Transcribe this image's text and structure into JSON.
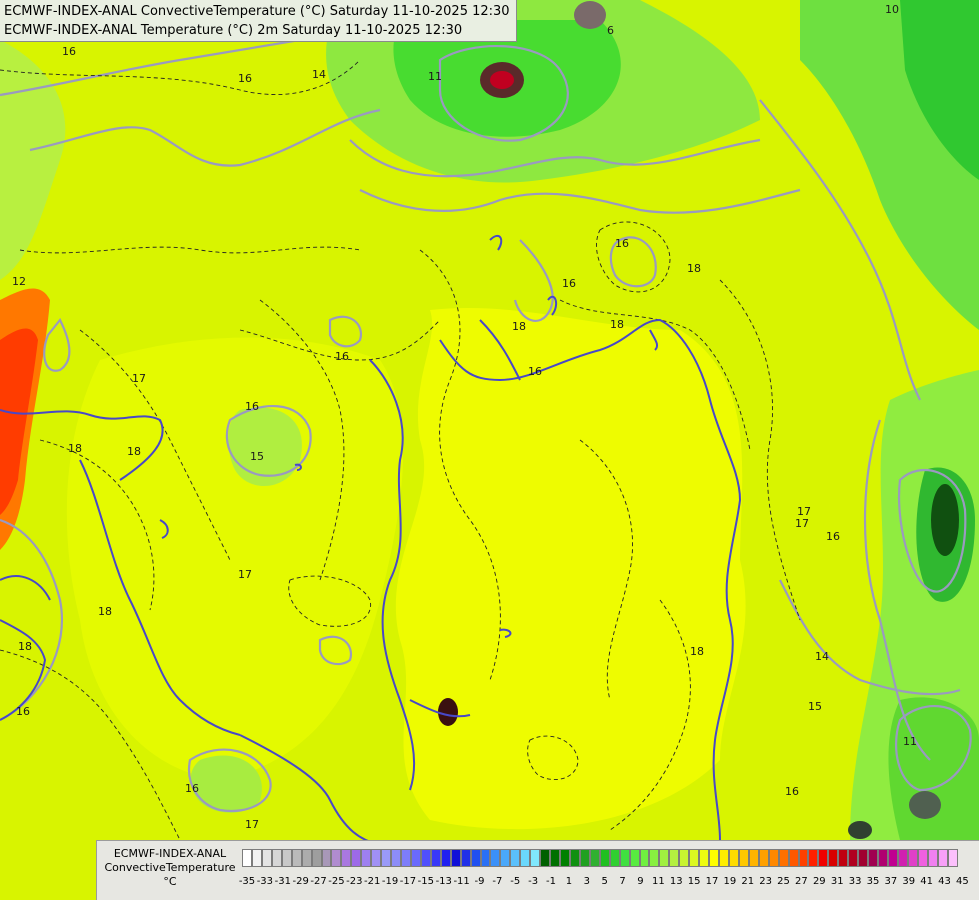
{
  "header": {
    "line1": "ECMWF-INDEX-ANAL ConvectiveTemperature (°C) Saturday 11-10-2025 12:30",
    "line2": "ECMWF-INDEX-ANAL Temperature (°C) 2m Saturday 11-10-2025 12:30"
  },
  "legend": {
    "title_line1": "ECMWF-INDEX-ANAL",
    "title_line2": "ConvectiveTemperature",
    "title_line3": "°C",
    "tick_labels": [
      "-35",
      "-33",
      "-31",
      "-29",
      "-27",
      "-25",
      "-23",
      "-21",
      "-19",
      "-17",
      "-15",
      "-13",
      "-11",
      "-9",
      "-7",
      "-5",
      "-3",
      "-1",
      "1",
      "3",
      "5",
      "7",
      "9",
      "11",
      "13",
      "15",
      "17",
      "19",
      "21",
      "23",
      "25",
      "27",
      "29",
      "31",
      "33",
      "35",
      "37",
      "39",
      "41",
      "43",
      "45"
    ],
    "colors": [
      "#ffffff",
      "#f2f2f2",
      "#e4e4e4",
      "#d6d6d6",
      "#c8c8c8",
      "#bababa",
      "#acacac",
      "#9e9e9e",
      "#a898b8",
      "#b08cd0",
      "#a978e0",
      "#9d6ae8",
      "#9e80f0",
      "#a090f5",
      "#9a9af8",
      "#8d8df8",
      "#7d7dfa",
      "#6a6afc",
      "#5050fc",
      "#3838f8",
      "#2020f0",
      "#1010d8",
      "#2030e8",
      "#2050f0",
      "#2a70f5",
      "#3a90f8",
      "#4aa8fa",
      "#5ac0fb",
      "#6ad8fc",
      "#80e8fd",
      "#006000",
      "#007000",
      "#008000",
      "#109010",
      "#20a020",
      "#30b030",
      "#20c020",
      "#30d030",
      "#40e040",
      "#58ec40",
      "#70f040",
      "#88f040",
      "#a0f040",
      "#b4f040",
      "#c8f430",
      "#dcf820",
      "#eefc10",
      "#ffff00",
      "#ffee00",
      "#ffdc00",
      "#ffc800",
      "#ffb400",
      "#ffa000",
      "#ff8800",
      "#ff7000",
      "#ff5800",
      "#ff4000",
      "#ff2000",
      "#f00000",
      "#d80000",
      "#c00010",
      "#b00020",
      "#a00030",
      "#a00050",
      "#b00070",
      "#c00090",
      "#d020b0",
      "#e040c8",
      "#f060e0",
      "#f080f0",
      "#f8a0f8",
      "#fcc0fc"
    ]
  },
  "contour_labels": [
    {
      "text": "16",
      "kind": "thin"
    },
    {
      "text": "14",
      "kind": "thin"
    },
    {
      "text": "16",
      "kind": "thin"
    },
    {
      "text": "11",
      "kind": "thin"
    },
    {
      "text": "6",
      "kind": "thin"
    },
    {
      "text": "10",
      "kind": "thin"
    },
    {
      "text": "12",
      "kind": "thin"
    },
    {
      "text": "17",
      "kind": "thin"
    },
    {
      "text": "16",
      "kind": "thin"
    },
    {
      "text": "18",
      "kind": "thin"
    },
    {
      "text": "18",
      "kind": "thin"
    },
    {
      "text": "16",
      "kind": "thin"
    },
    {
      "text": "18",
      "kind": "thin"
    },
    {
      "text": "18",
      "kind": "thin"
    },
    {
      "text": "16",
      "kind": "thin"
    },
    {
      "text": "15",
      "kind": "thin"
    },
    {
      "text": "17",
      "kind": "thin"
    },
    {
      "text": "18",
      "kind": "thin"
    },
    {
      "text": "18",
      "kind": "thin"
    },
    {
      "text": "16",
      "kind": "thin"
    },
    {
      "text": "16",
      "kind": "thin"
    },
    {
      "text": "17",
      "kind": "thin"
    },
    {
      "text": "18",
      "kind": "thin"
    },
    {
      "text": "17",
      "kind": "thin"
    },
    {
      "text": "16",
      "kind": "thin"
    },
    {
      "text": "14",
      "kind": "thin"
    },
    {
      "text": "15",
      "kind": "thin"
    },
    {
      "text": "16",
      "kind": "thin"
    },
    {
      "text": "11",
      "kind": "thin"
    },
    {
      "text": "17",
      "kind": "thin"
    },
    {
      "text": "16",
      "kind": "thin"
    },
    {
      "text": "18",
      "kind": "thin"
    },
    {
      "text": "16",
      "kind": "thin"
    },
    {
      "text": "18",
      "kind": "thin"
    }
  ]
}
